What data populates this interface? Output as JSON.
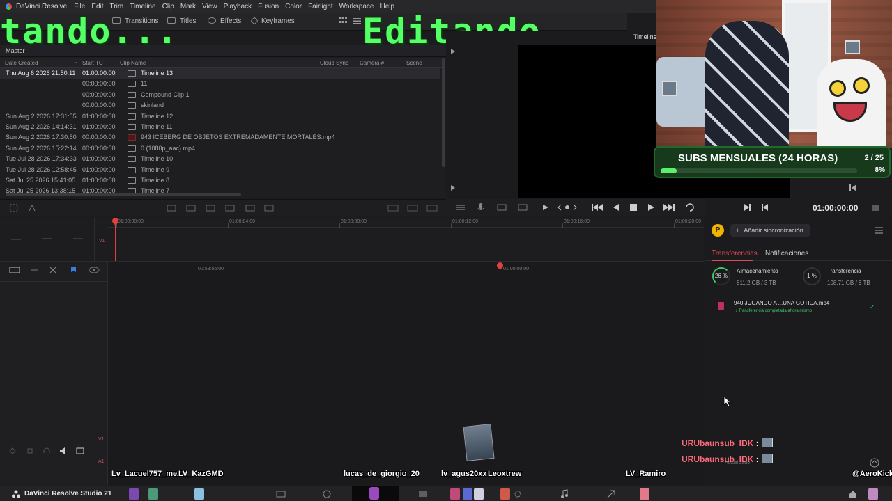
{
  "menubar": {
    "app_name": "DaVinci Resolve",
    "items": [
      "File",
      "Edit",
      "Trim",
      "Timeline",
      "Clip",
      "Mark",
      "View",
      "Playback",
      "Fusion",
      "Color",
      "Fairlight",
      "Workspace",
      "Help"
    ]
  },
  "toolbar": {
    "transitions": "Transitions",
    "titles": "Titles",
    "effects": "Effects",
    "keyframes": "Keyframes"
  },
  "overlay": {
    "left_text": "tando...",
    "right_text": "Editando..."
  },
  "viewer": {
    "title": "Timeline",
    "timecode": "01:00:00:00"
  },
  "media_pool": {
    "bin": "Master",
    "columns": [
      "Date Created",
      "Start TC",
      "Clip Name",
      "Cloud Sync",
      "Camera #",
      "Scene"
    ],
    "rows": [
      {
        "date": "Thu Aug 6 2026 21:50:11",
        "tc": "01:00:00:00",
        "name": "Timeline 13",
        "selected": true,
        "kind": "timeline"
      },
      {
        "date": "",
        "tc": "00:00:00:00",
        "name": "11",
        "selected": false,
        "kind": "clip"
      },
      {
        "date": "",
        "tc": "00:00:00:00",
        "name": "Compound Clip 1",
        "selected": false,
        "kind": "clip"
      },
      {
        "date": "",
        "tc": "00:00:00:00",
        "name": "skinland",
        "selected": false,
        "kind": "clip"
      },
      {
        "date": "Sun Aug 2 2026 17:31:55",
        "tc": "01:00:00:00",
        "name": "Timeline 12",
        "selected": false,
        "kind": "timeline"
      },
      {
        "date": "Sun Aug 2 2026 14:14:31",
        "tc": "01:00:00:00",
        "name": "Timeline 11",
        "selected": false,
        "kind": "timeline"
      },
      {
        "date": "Sun Aug 2 2026 17:30:50",
        "tc": "00:00:00:00",
        "name": "943 ICEBERG DE OBJETOS EXTREMADAMENTE MORTALES.mp4",
        "selected": false,
        "kind": "video"
      },
      {
        "date": "Sun Aug 2 2026 15:22:14",
        "tc": "00:00:00:00",
        "name": "0 (1080p_aac).mp4",
        "selected": false,
        "kind": "clip"
      },
      {
        "date": "Tue Jul 28 2026 17:34:33",
        "tc": "01:00:00:00",
        "name": "Timeline 10",
        "selected": false,
        "kind": "timeline"
      },
      {
        "date": "Tue Jul 28 2026 12:58:45",
        "tc": "01:00:00:00",
        "name": "Timeline 9",
        "selected": false,
        "kind": "timeline"
      },
      {
        "date": "Sat Jul 25 2026 15:41:05",
        "tc": "01:00:00:00",
        "name": "Timeline 8",
        "selected": false,
        "kind": "timeline"
      },
      {
        "date": "Sat Jul 25 2026 13:38:15",
        "tc": "01:00:00:00",
        "name": "Timeline 7",
        "selected": false,
        "kind": "timeline"
      }
    ]
  },
  "subs": {
    "title": "SUBS MENSUALES (24 HORAS)",
    "count": "2 / 25",
    "percent_label": "8%",
    "progress": 0.08
  },
  "timeline": {
    "ruler_ticks": [
      "01:00:00:00",
      "01:00:04:00",
      "01:00:08:00",
      "01:00:12:00",
      "01:00:16:00",
      "01:00:20:00"
    ],
    "lower_ticks": [
      "00:59:56:00",
      "01:00:00:00"
    ],
    "track_v1": "V1",
    "track_a1": "A1"
  },
  "cloud_panel": {
    "avatar_letter": "P",
    "sync_button": "Añadir sincronización",
    "tab_transfers": "Transferencias",
    "tab_notifications": "Notificaciones",
    "storage_pct": "26 %",
    "storage_title": "Almacenamiento",
    "storage_val": "811.2 GB / 3 TB",
    "transfer_pct": "1 %",
    "transfer_title": "Transferencia",
    "transfer_val": "108.71 GB / 6 TB",
    "file_name": "940 JUGANDO A ...UNA GOTICA.mp4",
    "file_status": "Transferencia completada ahora mismo",
    "footer_status": "Actualizado"
  },
  "chat": [
    {
      "user": "URUbaunsub_IDK",
      "colon": ":"
    },
    {
      "user": "URUbaunsub_IDK",
      "colon": ":"
    }
  ],
  "viewers": [
    "Lv_Lacuel757_me23",
    "LV_KazGMD",
    "lucas_de_giorgio_20",
    "lv_agus20xx",
    "Leoxtrew",
    "LV_Ramiro",
    "@AeroKick"
  ],
  "bottom": {
    "app_label": "DaVinci Resolve Studio 21"
  },
  "colors": {
    "accent_red": "#e04757",
    "playhead": "#e04040",
    "overlay_green": "#55ff66",
    "subs_fill": "#5cf06a"
  }
}
